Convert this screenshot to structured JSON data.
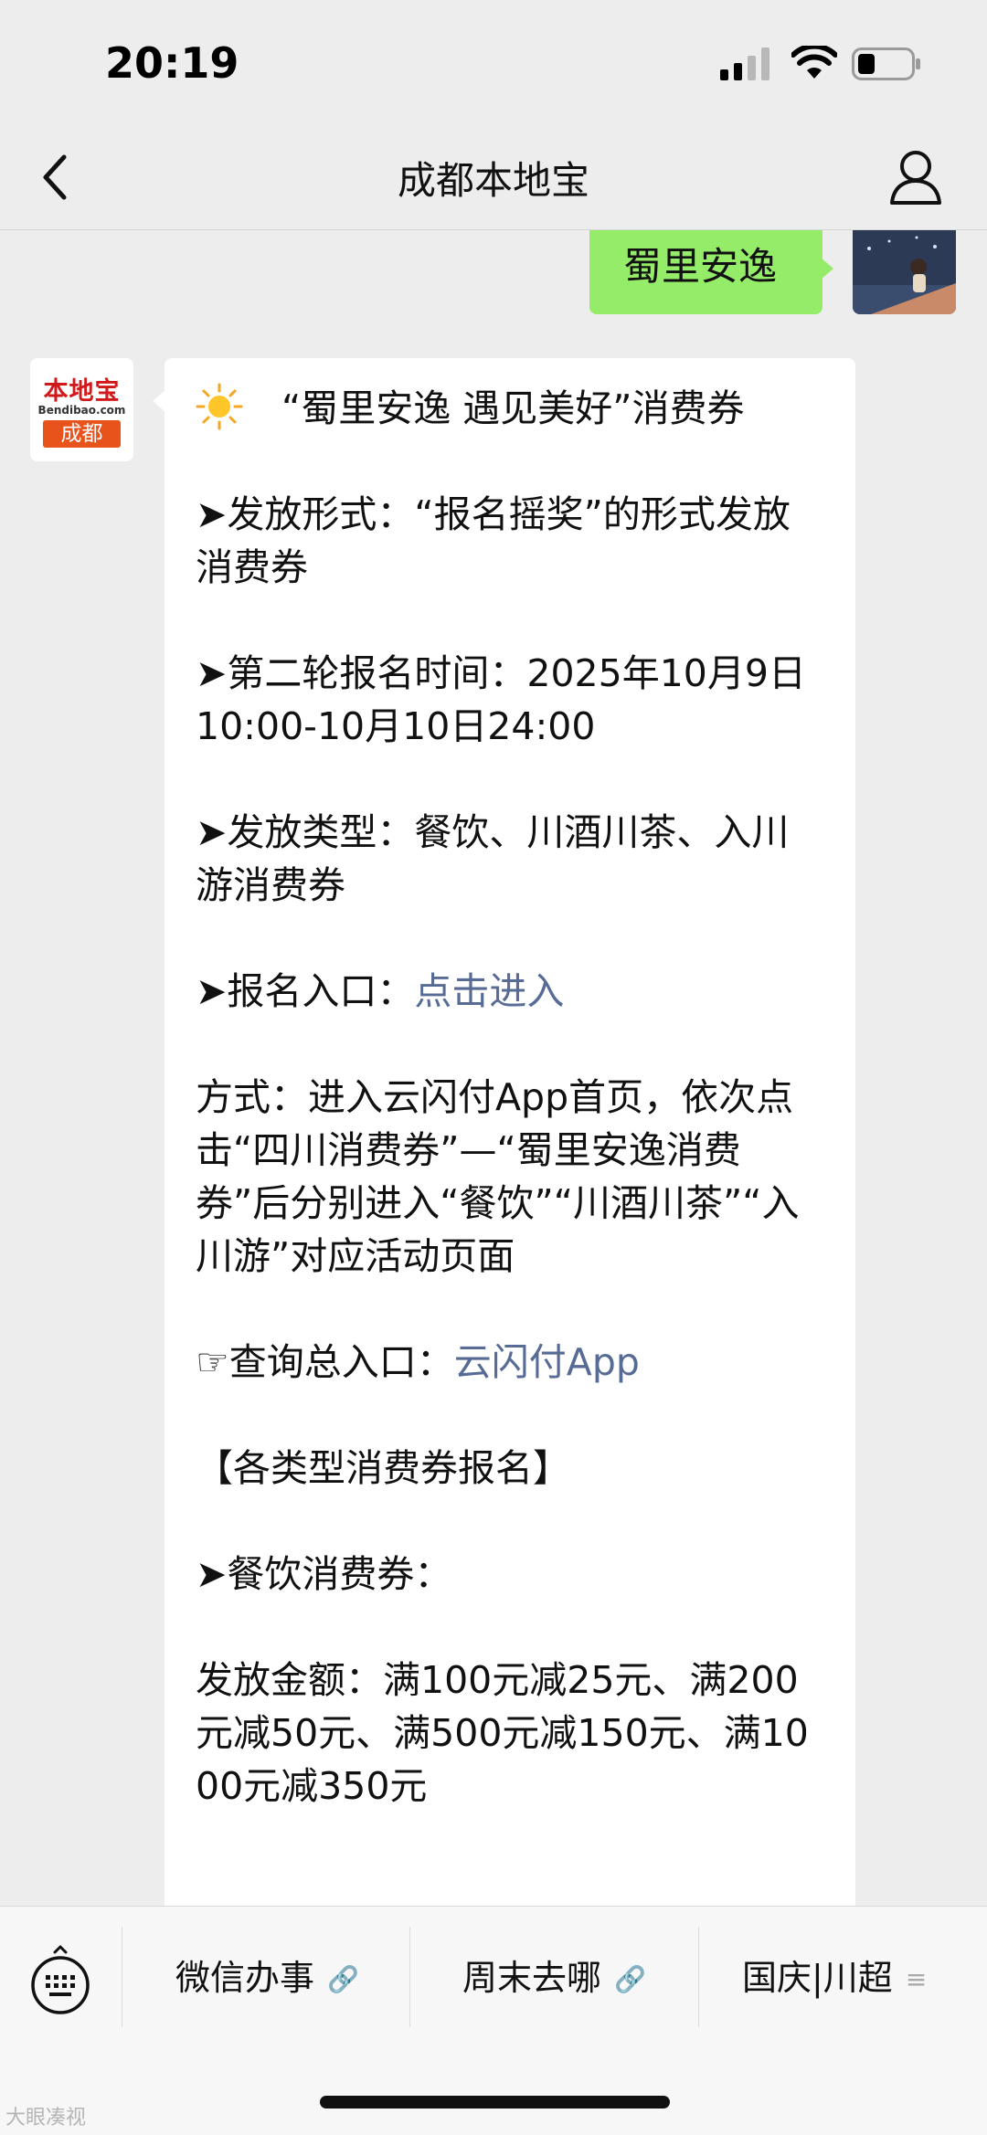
{
  "status_bar": {
    "time": "20:19"
  },
  "nav": {
    "title": "成都本地宝"
  },
  "outgoing_message": {
    "text": "蜀里安逸"
  },
  "sender_avatar": {
    "logo_top": "本地宝",
    "logo_mid": "Bendibao.com",
    "logo_bottom": "成都"
  },
  "message": {
    "title": "“蜀里安逸 遇见美好”消费券",
    "p1": "➤发放形式：“报名摇奖”的形式发放消费券",
    "p2": "➤第二轮报名时间：2025年10月9日10:00-10月10日24:00",
    "p3": "➤发放类型：餐饮、川酒川茶、入川游消费券",
    "p4_prefix": "➤报名入口：",
    "p4_link": "点击进入",
    "p5": "方式：进入云闪付App首页，依次点击“四川消费券”—“蜀里安逸消费券”后分别进入“餐饮”“川酒川茶”“入川游”对应活动页面",
    "p6_prefix": "☞查询总入口：",
    "p6_link": "云闪付App",
    "p7": "【各类型消费券报名】",
    "p8": "➤餐饮消费券：",
    "p9": "发放金额：满100元减25元、满200元减50元、满500元减150元、满1000元减350元"
  },
  "bottom_menu": {
    "items": [
      {
        "label": "微信办事",
        "suffix": "🔗"
      },
      {
        "label": "周末去哪",
        "suffix": "🔗"
      },
      {
        "label": "国庆|川超",
        "suffix": "≡"
      }
    ]
  },
  "watermark": "大眼凑视"
}
